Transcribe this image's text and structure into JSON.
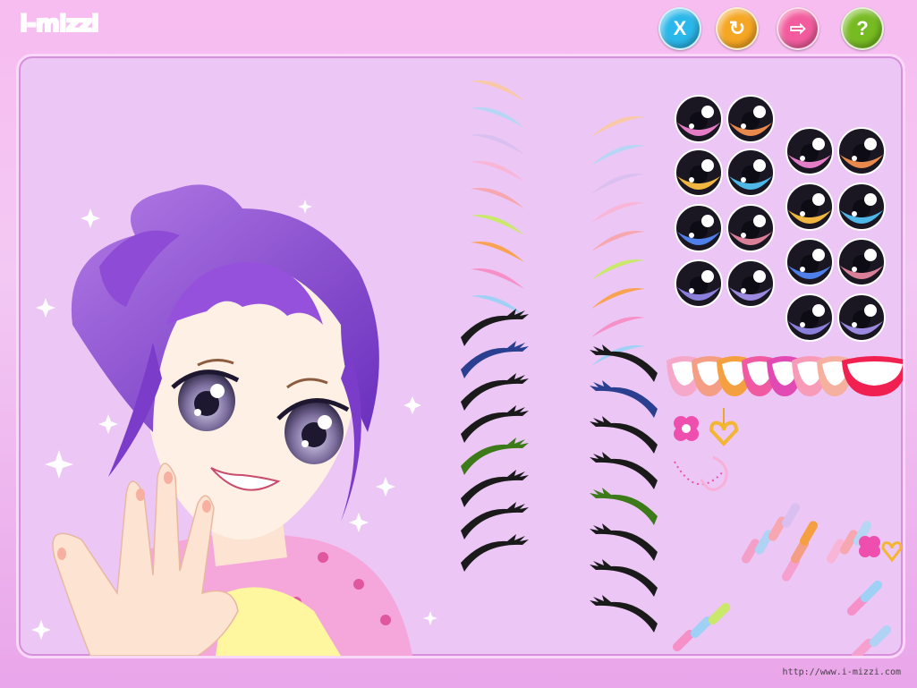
{
  "brand": {
    "logo_text": "i-mizzi"
  },
  "toolbar": {
    "buttons": [
      {
        "name": "close-button",
        "glyph": "X",
        "color": "#2ab7e9"
      },
      {
        "name": "reset-button",
        "glyph": "↻",
        "color": "#f5a623"
      },
      {
        "name": "next-button",
        "glyph": "⇨",
        "color": "#f25c9e"
      },
      {
        "name": "help-button",
        "glyph": "?",
        "color": "#77bb22"
      }
    ]
  },
  "footer": {
    "url": "http://www.i-mizzi.com"
  },
  "palette": {
    "eyebrow_colors": [
      "#f9c9a7",
      "#b6d6f5",
      "#d9c0f0",
      "#f9b5d5",
      "#f7a7b0",
      "#c9e86c",
      "#f9a352",
      "#f690c8",
      "#9fd0f5"
    ],
    "eye_iris_colors": [
      "#e47cc6",
      "#e98a4c",
      "#f0b640",
      "#4fb6e8",
      "#4f7fe8",
      "#d98098",
      "#8a7fd9",
      "#9b8ae0"
    ],
    "lip_colors": [
      "#f6a8cb",
      "#f49e86",
      "#f5a040",
      "#f05aa0",
      "#e24ab3",
      "#f79bb8",
      "#f6b0a0",
      "#f02050"
    ],
    "lash_tint_colors": [
      "#1a1a1a",
      "#2a3f8f",
      "#1a1a1a",
      "#1a1a1a",
      "#3d7a1a",
      "#1a1a1a",
      "#1a1a1a",
      "#1a1a1a"
    ]
  }
}
